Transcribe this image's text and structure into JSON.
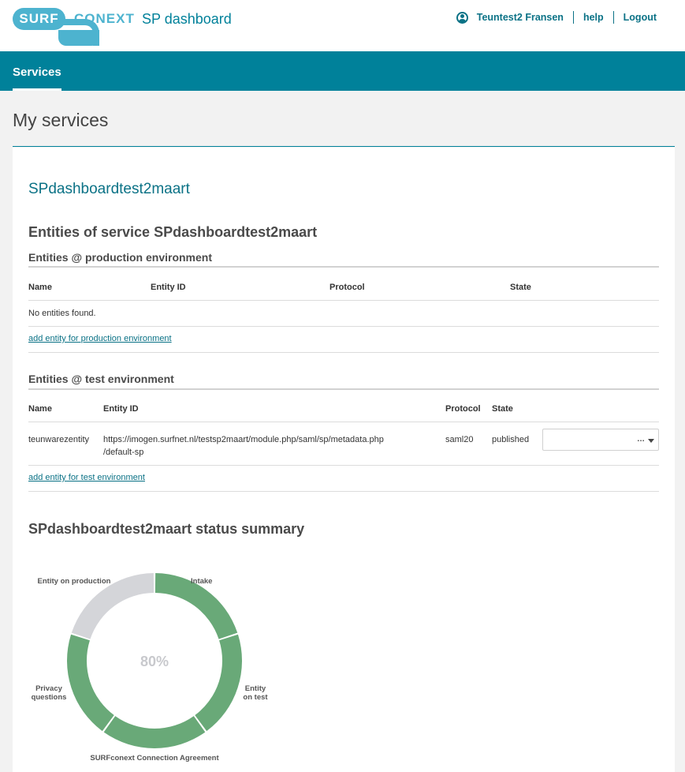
{
  "header": {
    "logo_text_left": "SURF",
    "logo_text_right": "CONEXT",
    "app_title": "SP dashboard",
    "user_name": "Teuntest2 Fransen",
    "help_label": "help",
    "logout_label": "Logout"
  },
  "nav": {
    "tab_services": "Services"
  },
  "page": {
    "title": "My services"
  },
  "service": {
    "name": "SPdashboardtest2maart",
    "entities_heading": "Entities of service SPdashboardtest2maart",
    "production": {
      "heading": "Entities @ production environment",
      "columns": [
        "Name",
        "Entity ID",
        "Protocol",
        "State"
      ],
      "empty_text": "No entities found.",
      "add_link": "add entity for production environment"
    },
    "test": {
      "heading": "Entities @ test environment",
      "columns": [
        "Name",
        "Entity ID",
        "Protocol",
        "State"
      ],
      "rows": [
        {
          "name": "teunwarezentity",
          "entity_id_line1": "https://imogen.surfnet.nl/testsp2maart/module.php/saml/sp/metadata.php",
          "entity_id_line2": "/default-sp",
          "protocol": "saml20",
          "state": "published",
          "actions_value": "…"
        }
      ],
      "add_link": "add entity for test environment"
    },
    "summary_heading": "SPdashboardtest2maart status summary"
  },
  "chart_data": {
    "type": "pie",
    "center_label": "80%",
    "segments": [
      {
        "label": "Intake",
        "done": true
      },
      {
        "label": "Entity on test",
        "done": true
      },
      {
        "label": "SURFconext Connection Agreement",
        "done": true
      },
      {
        "label": "Privacy questions",
        "done": true
      },
      {
        "label": "Entity on production",
        "done": false
      }
    ],
    "colors": {
      "done": "#69a978",
      "todo": "#d4d5d9",
      "center": "#c8c9cd"
    }
  }
}
